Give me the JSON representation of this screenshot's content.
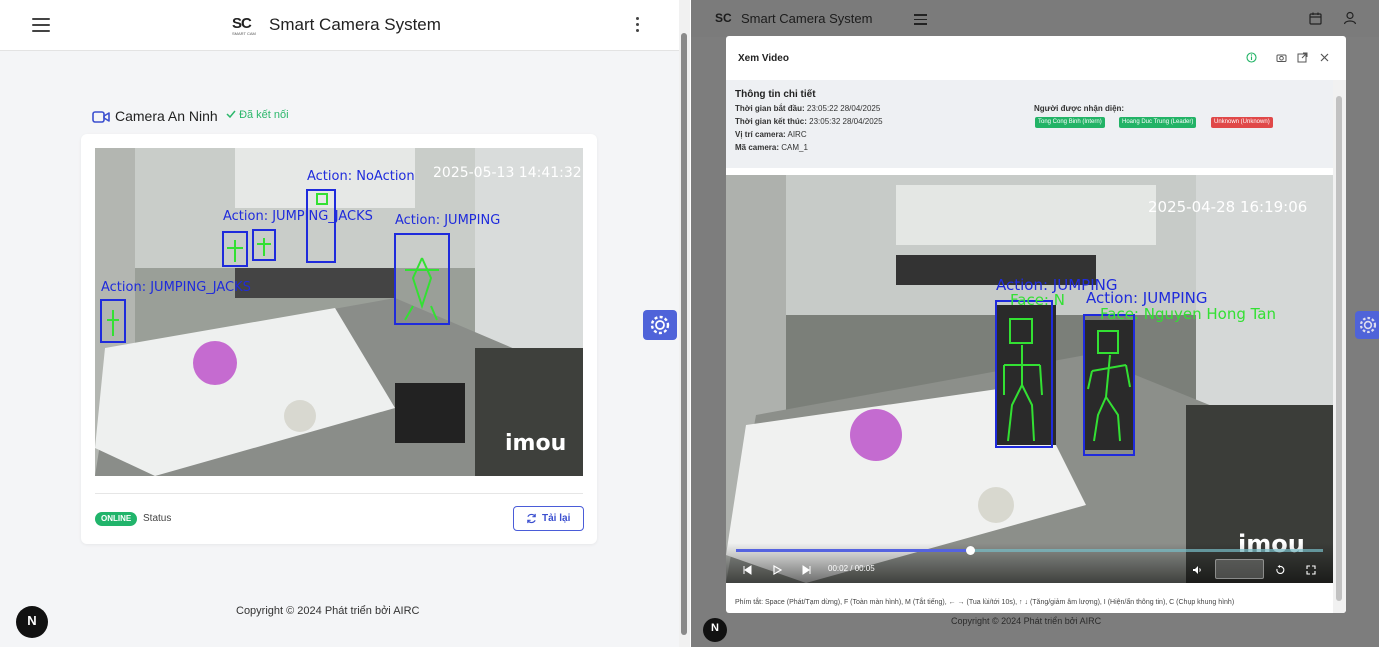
{
  "app": {
    "title": "Smart Camera System",
    "logo_text": "SC",
    "logo_sub": "SMART CAM"
  },
  "colors": {
    "accent": "#4f63d9",
    "online": "#21b46b",
    "connected": "#2cb76b",
    "tag_green": "#22b366",
    "tag_red": "#e04848",
    "box_blue": "#1f2bdc",
    "skeleton_green": "#33e033"
  },
  "left": {
    "camera_title": "Camera An Ninh",
    "connection_status": "Đã kết nối",
    "feed": {
      "timestamp": "2025-05-13 14:41:32",
      "watermark": "imou",
      "labels": [
        "Action: NoAction",
        "Action: JUMPING_JACKS",
        "Action: JUMPING",
        "Action: JUMPING_JACKS"
      ]
    },
    "online_badge": "ONLINE",
    "status_label": "Status",
    "reload_button": "Tải lại",
    "copyright": {
      "prefix": "Copyright © 2024  Phát triển bởi",
      "org": "AIRC"
    }
  },
  "right": {
    "copyright": {
      "prefix": "Copyright © 2024  Phát triển bởi",
      "org": "AIRC"
    },
    "modal": {
      "title": "Xem Video",
      "info_title": "Thông tin chi tiết",
      "fields": [
        {
          "label": "Thời gian bắt đầu:",
          "value": "23:05:22 28/04/2025"
        },
        {
          "label": "Thời gian kết thúc:",
          "value": "23:05:32 28/04/2025"
        },
        {
          "label": "Vị trí camera:",
          "value": "AIRC"
        },
        {
          "label": "Mã camera:",
          "value": "CAM_1"
        }
      ],
      "recognized_label": "Người được nhận diện:",
      "tags": [
        {
          "text": "Tong Cong Binh (Intern)",
          "color": "#22b366"
        },
        {
          "text": "Hoang Duc Trung (Leader)",
          "color": "#22b366"
        },
        {
          "text": "Unknown (Unknown)",
          "color": "#e04848"
        }
      ],
      "feed": {
        "timestamp": "2025-04-28 16:19:06",
        "watermark": "imou",
        "labels": [
          "Action: JUMPING",
          "Face: N",
          "Action: JUMPING",
          "Face: Nguyen Hong Tan"
        ]
      },
      "player": {
        "time": "00:02 / 00:05",
        "progress": 0.4
      },
      "shortcuts": "Phím tắt: Space (Phát/Tạm dừng), F (Toàn màn hình), M (Tắt tiếng), ← → (Tua lùi/tới 10s), ↑ ↓ (Tăng/giảm âm lượng), I (Hiện/ẩn thông tin), C (Chụp khung hình)"
    }
  },
  "next_badge": "N"
}
